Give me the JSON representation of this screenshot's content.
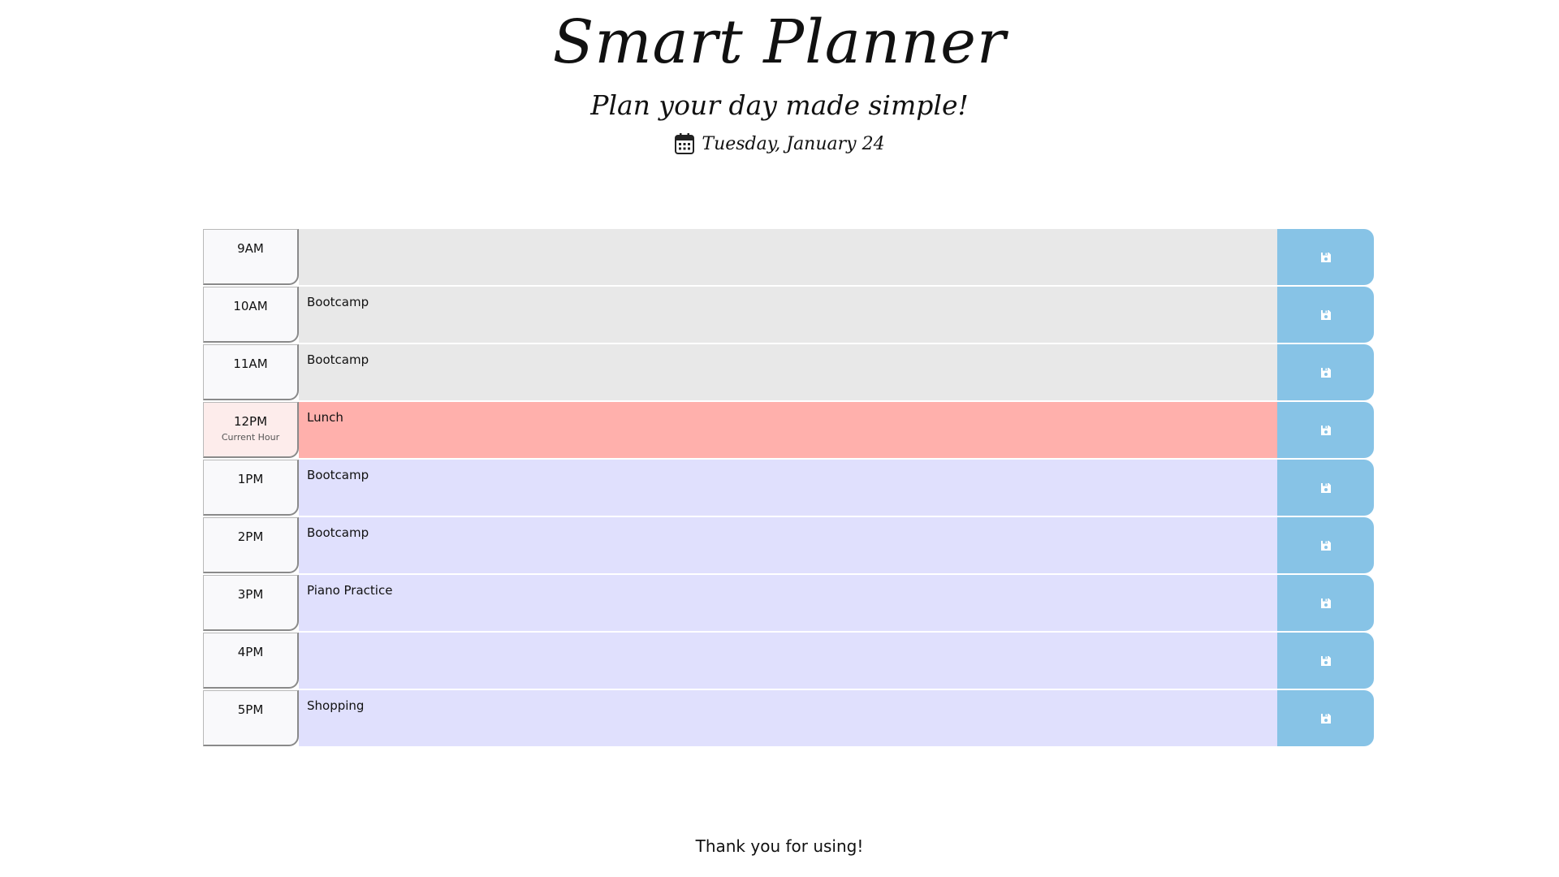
{
  "header": {
    "title": "Smart Planner",
    "tagline": "Plan your day made simple!",
    "date": "Tuesday, January 24",
    "date_icon": "calendar-icon"
  },
  "planner": {
    "save_icon": "floppy-disk-icon",
    "rows": [
      {
        "hour": "9AM",
        "task": "",
        "state": "past"
      },
      {
        "hour": "10AM",
        "task": "Bootcamp",
        "state": "past"
      },
      {
        "hour": "11AM",
        "task": "Bootcamp",
        "state": "past"
      },
      {
        "hour": "12PM",
        "sub": "Current Hour",
        "task": "Lunch",
        "state": "present"
      },
      {
        "hour": "1PM",
        "task": "Bootcamp",
        "state": "future"
      },
      {
        "hour": "2PM",
        "task": "Bootcamp",
        "state": "future"
      },
      {
        "hour": "3PM",
        "task": "Piano Practice",
        "state": "future"
      },
      {
        "hour": "4PM",
        "task": "",
        "state": "future"
      },
      {
        "hour": "5PM",
        "task": "Shopping",
        "state": "future"
      }
    ]
  },
  "colors": {
    "past": "#e8e8e8",
    "present": "#ffb0ac",
    "future": "#e0e0fd",
    "save_button": "#87c3e6"
  },
  "footer": {
    "text": "Thank you for using!"
  }
}
